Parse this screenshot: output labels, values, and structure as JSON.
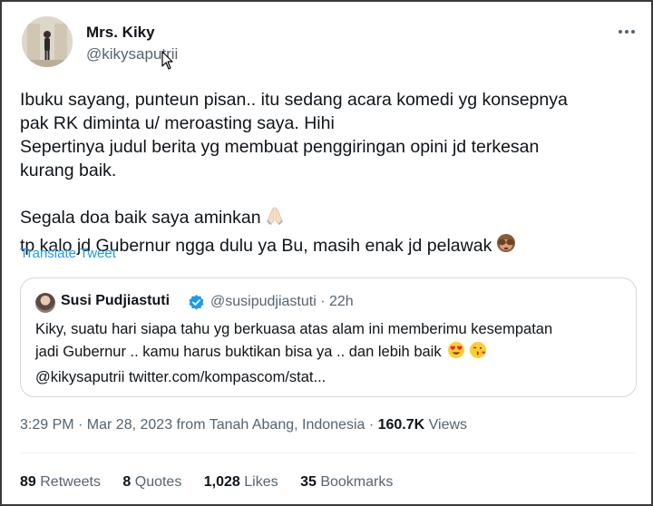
{
  "author": {
    "name": "Mrs. Kiky",
    "handle": "@kikysaputrii"
  },
  "tweet": {
    "lines": [
      "Ibuku sayang, punteun pisan.. itu sedang acara komedi yg konsepnya",
      "pak RK diminta u/ meroasting saya. Hihi",
      "Sepertinya judul berita yg membuat penggiringan opini jd terkesan",
      "kurang baik.",
      "",
      "Segala doa baik saya aminkan",
      "tp kalo jd Gubernur ngga dulu ya Bu, masih enak jd pelawak"
    ],
    "emoji_line6": "folded-hands-emoji",
    "emoji_line7": "see-no-evil-monkey-emoji"
  },
  "translate_label": "Translate Tweet",
  "quoted": {
    "name": "Susi Pudjiastuti",
    "handle_time": "@susipudjiastuti · 22h",
    "lines": [
      "Kiky, suatu hari siapa tahu yg berkuasa atas alam ini memberimu kesempatan",
      "jadi Gubernur .. kamu harus buktikan bisa ya .. dan lebih baik",
      "@kikysaputrii twitter.com/kompascom/stat..."
    ],
    "emojis": [
      "heart-eyes-emoji",
      "kissing-face-emoji"
    ]
  },
  "meta": {
    "time_date_location": "3:29 PM · Mar 28, 2023 from Tanah Abang, Indonesia · ",
    "views_count": "160.7K",
    "views_label": " Views"
  },
  "stats": [
    {
      "count": "89",
      "label": " Retweets"
    },
    {
      "count": "8",
      "label": " Quotes"
    },
    {
      "count": "1,028",
      "label": " Likes"
    },
    {
      "count": "35",
      "label": " Bookmarks"
    }
  ],
  "colors": {
    "accent": "#1d9bf0",
    "secondary_text": "#536471",
    "primary_text": "#0f1419",
    "border": "#cfd9de"
  }
}
